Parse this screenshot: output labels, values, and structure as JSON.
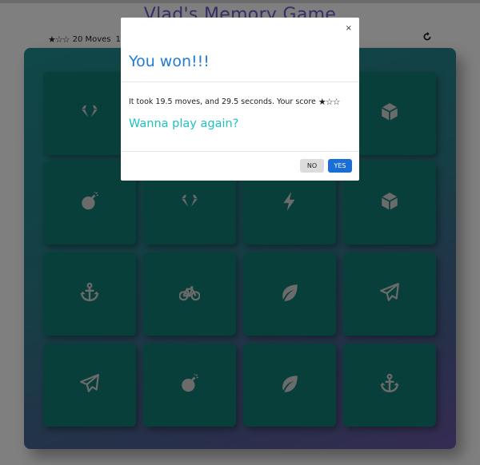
{
  "game": {
    "title": "Vlad's Memory Game",
    "score_panel": {
      "stars": "★☆☆",
      "moves": "20 Moves",
      "timer": "1",
      "restart_icon": "restart-icon"
    }
  },
  "deck": {
    "rows": 4,
    "cols": 4,
    "cards": [
      {
        "icon": "diamond-icon",
        "visible": true
      },
      {
        "icon": "",
        "visible": false
      },
      {
        "icon": "",
        "visible": false
      },
      {
        "icon": "cube-icon",
        "visible": true
      },
      {
        "icon": "bomb-icon",
        "visible": true
      },
      {
        "icon": "diamond-icon",
        "visible": true
      },
      {
        "icon": "bolt-icon",
        "visible": true
      },
      {
        "icon": "cube-icon",
        "visible": true
      },
      {
        "icon": "anchor-icon",
        "visible": true
      },
      {
        "icon": "bicycle-icon",
        "visible": true
      },
      {
        "icon": "leaf-icon",
        "visible": true
      },
      {
        "icon": "paper-plane-icon",
        "visible": true
      },
      {
        "icon": "paper-plane-icon",
        "visible": true
      },
      {
        "icon": "bomb-icon",
        "visible": true
      },
      {
        "icon": "leaf-icon",
        "visible": true
      },
      {
        "icon": "anchor-icon",
        "visible": true
      }
    ]
  },
  "modal": {
    "close_label": "×",
    "title": "You won!!!",
    "result_text": "It took 19.5 moves, and 29.5 seconds. Your score",
    "result_stars": "★☆☆",
    "question": "Wanna play again?",
    "no_label": "NO",
    "yes_label": "YES"
  },
  "colors": {
    "card": "#127f76",
    "icon": "#d7d7d7",
    "modal_title": "#1e7bd6",
    "question": "#1fc0c0",
    "yes_button": "#1a6fd6"
  }
}
